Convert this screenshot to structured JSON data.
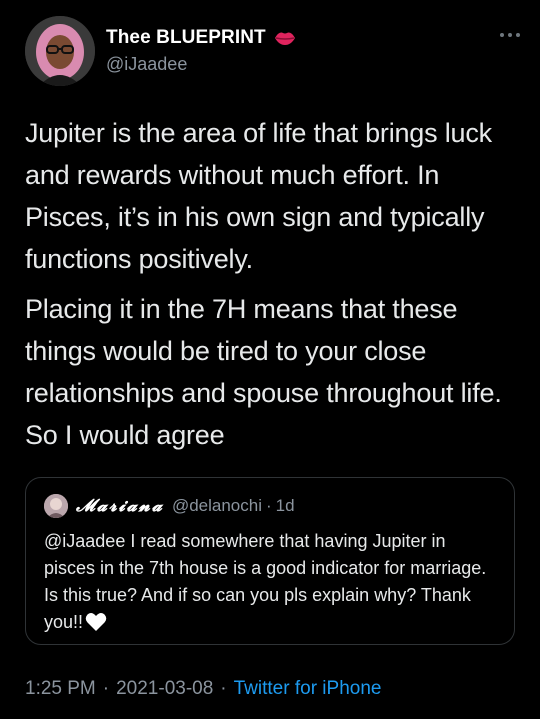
{
  "author": {
    "display_name": "Thee BLUEPRINT",
    "handle": "@iJaadee",
    "badge_icon": "lips-kiss-icon"
  },
  "tweet": {
    "paragraphs": [
      "Jupiter is the area of life that brings luck and rewards without much effort. In Pisces, it’s in his own sign and typically functions positively.",
      "Placing it in the 7H means that these things would be tired to your close relationships and spouse throughout life. So I would agree"
    ]
  },
  "quoted_tweet": {
    "display_name": "𝓜𝓪𝓻𝓲𝓪𝓷𝓪",
    "handle": "@delanochi",
    "separator": "·",
    "time": "1d",
    "text": "@iJaadee I read somewhere that having Jupiter in pisces in the 7th house is a good indicator for marriage. Is this true? And if so can you pls explain why? Thank you!!",
    "emoji": "white-heart-icon"
  },
  "meta": {
    "time": "1:25 PM",
    "separator": "·",
    "date": "2021-03-08",
    "source": "Twitter for iPhone"
  },
  "colors": {
    "background": "#000000",
    "text": "#e7e9ea",
    "muted": "#8b949e",
    "link": "#1d9bf0",
    "border": "#2f3336"
  }
}
